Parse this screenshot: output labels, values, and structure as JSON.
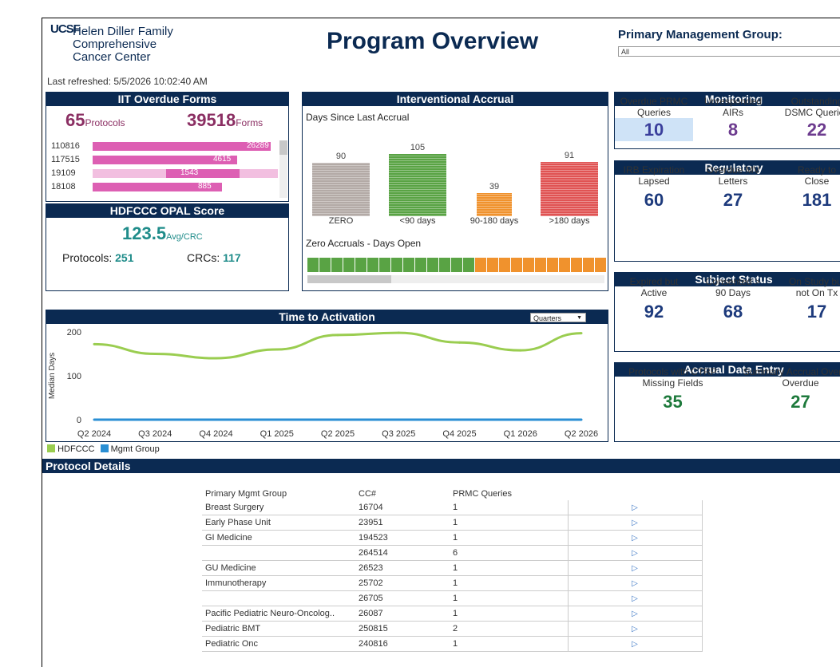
{
  "header": {
    "logo_mark": "UCSF",
    "logo_lines": [
      "Helen Diller Family",
      "Comprehensive",
      "Cancer Center"
    ],
    "title": "Program Overview",
    "filter_label": "Primary Management Group:",
    "filter_value": "All",
    "last_refreshed": "Last refreshed: 5/5/2026 10:02:40 AM"
  },
  "iit": {
    "title": "IIT Overdue Forms",
    "protocols_value": "65",
    "protocols_label": "Protocols",
    "forms_value": "39518",
    "forms_label": "Forms",
    "rows": [
      {
        "id": "110816",
        "value": "26289",
        "fraction": 0.96
      },
      {
        "id": "117515",
        "value": "4615",
        "fraction": 0.78
      },
      {
        "id": "19109",
        "value": "1543",
        "fraction": 0.58
      },
      {
        "id": "18108",
        "value": "885",
        "fraction": 0.7
      }
    ]
  },
  "opal": {
    "title": "HDFCCC OPAL Score",
    "score": "123.5",
    "score_unit": "Avg/CRC",
    "protocols_label": "Protocols:",
    "protocols_value": "251",
    "crcs_label": "CRCs:",
    "crcs_value": "117"
  },
  "accrual": {
    "title": "Interventional Accrual",
    "subtitle": "Days Since Last Accrual",
    "bars": [
      {
        "category": "ZERO",
        "value": 90,
        "color": "#b3aaa6"
      },
      {
        "category": "<90 days",
        "value": 105,
        "color": "#59a344"
      },
      {
        "category": "90-180 days",
        "value": 39,
        "color": "#f0922d"
      },
      {
        "category": ">180 days",
        "value": 91,
        "color": "#e05353"
      }
    ],
    "zero_title": "Zero Accruals - Days Open",
    "zero_squares": [
      "#59a344",
      "#59a344",
      "#59a344",
      "#59a344",
      "#59a344",
      "#59a344",
      "#59a344",
      "#59a344",
      "#59a344",
      "#59a344",
      "#59a344",
      "#59a344",
      "#59a344",
      "#59a344",
      "#f0922d",
      "#f0922d",
      "#f0922d",
      "#f0922d",
      "#f0922d",
      "#f0922d",
      "#f0922d",
      "#f0922d",
      "#f0922d",
      "#f0922d",
      "#f0922d"
    ]
  },
  "monitoring": {
    "title": "Monitoring",
    "items": [
      {
        "label_1": "Overdue PRMC",
        "label_2": "Queries",
        "value": "10",
        "color": "#3a3f9c"
      },
      {
        "label_1": "Unresponded",
        "label_2": "AIRs",
        "value": "8",
        "color": "#6d3c8f"
      },
      {
        "label_1": "Outstanding",
        "label_2": "DSMC Queries",
        "value": "22",
        "color": "#6d3c8f"
      }
    ]
  },
  "regulatory": {
    "title": "Regulatory",
    "items": [
      {
        "label_1": "IRB Expiration",
        "label_2": "Lapsed",
        "value": "60"
      },
      {
        "label_1": "Overdue MV",
        "label_2": "Letters",
        "value": "27"
      },
      {
        "label_1": "Ready to",
        "label_2": "Close",
        "value": "181"
      }
    ]
  },
  "subject": {
    "title": "Subject Status",
    "items": [
      {
        "label_1": "Expired but",
        "label_2": "Active",
        "value": "92"
      },
      {
        "label_1": "Consented >",
        "label_2": "90 Days",
        "value": "68"
      },
      {
        "label_1": "On Study but",
        "label_2": "not On Tx",
        "value": "17"
      }
    ]
  },
  "accrual_entry": {
    "title": "Accrual Data Entry",
    "items": [
      {
        "label_1": "Protocols with CTRP",
        "label_2": "Missing Fields",
        "value": "35"
      },
      {
        "label_1": "Summary Accrual Overdue",
        "label_2": "Overdue",
        "value": "27"
      }
    ]
  },
  "activation": {
    "title": "Time to Activation",
    "dropdown": "Quarters",
    "ylabel": "Median Days"
  },
  "chart_data": {
    "type": "line",
    "title": "Time to Activation",
    "ylabel": "Median Days",
    "xlabel": "",
    "ylim": [
      0,
      200
    ],
    "yticks": [
      0,
      100,
      200
    ],
    "x": [
      "Q2 2024",
      "Q3 2024",
      "Q4 2024",
      "Q1 2025",
      "Q2 2025",
      "Q3 2025",
      "Q4 2025",
      "Q1 2026",
      "Q2 2026"
    ],
    "series": [
      {
        "name": "HDFCCC",
        "color": "#9acd50",
        "values": [
          172,
          150,
          140,
          160,
          193,
          198,
          176,
          158,
          197
        ]
      },
      {
        "name": "Mgmt Group",
        "color": "#2a8fd4",
        "values": [
          0,
          0,
          0,
          0,
          0,
          0,
          0,
          0,
          0
        ]
      }
    ],
    "legend": "bottom-left"
  },
  "protocol_details": {
    "title": "Protocol Details",
    "columns": [
      "Primary Mgmt Group",
      "CC#",
      "PRMC Queries"
    ],
    "rows": [
      {
        "group": "Breast Surgery",
        "cc": "16704",
        "queries": "1"
      },
      {
        "group": "Early Phase Unit",
        "cc": "23951",
        "queries": "1"
      },
      {
        "group": "GI Medicine",
        "cc": "194523",
        "queries": "1"
      },
      {
        "group": "",
        "cc": "264514",
        "queries": "6"
      },
      {
        "group": "GU Medicine",
        "cc": "26523",
        "queries": "1"
      },
      {
        "group": "Immunotherapy",
        "cc": "25702",
        "queries": "1"
      },
      {
        "group": "",
        "cc": "26705",
        "queries": "1"
      },
      {
        "group": "Pacific Pediatric Neuro-Oncolog..",
        "cc": "26087",
        "queries": "1"
      },
      {
        "group": "Pediatric BMT",
        "cc": "250815",
        "queries": "2"
      },
      {
        "group": "Pediatric Onc",
        "cc": "240816",
        "queries": "1"
      }
    ]
  }
}
